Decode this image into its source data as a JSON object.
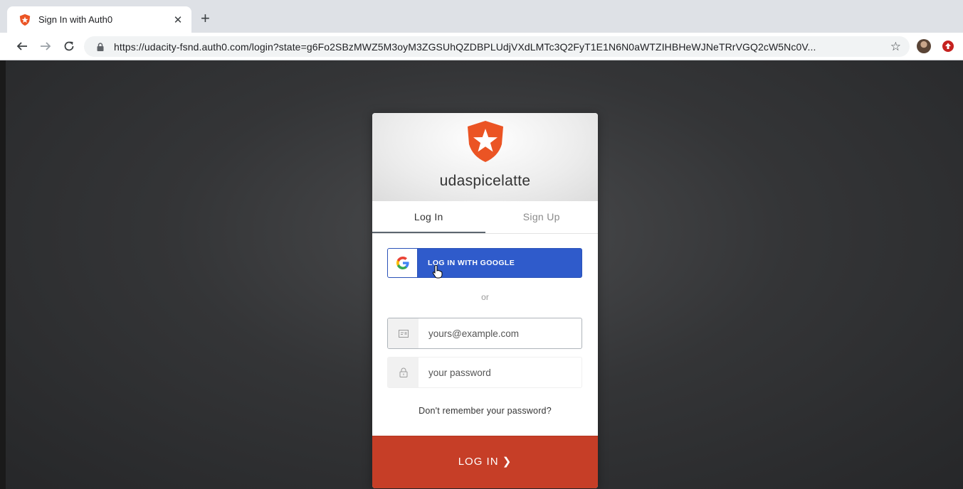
{
  "browser": {
    "tab_title": "Sign In with Auth0",
    "close_glyph": "✕",
    "new_tab_glyph": "+",
    "url_host": "https://udacity-fsnd.auth0.com",
    "url_rest": "/login?state=g6Fo2SBzMWZ5M3oyM3ZGSUhQZDBPLUdjVXdLMTc3Q2FyT1E1N6N0aWTZIHBHeWJNeTRrVGQ2cW5Nc0V...",
    "star_glyph": "☆",
    "icons": [
      "back-icon",
      "forward-icon",
      "reload-icon",
      "lock-icon",
      "star-icon",
      "profile-avatar",
      "extension-icon"
    ]
  },
  "widget": {
    "app_name": "udaspicelatte",
    "tabs": [
      {
        "label": "Log In"
      },
      {
        "label": "Sign Up"
      }
    ],
    "google_button_label": "LOG IN WITH GOOGLE",
    "separator": "or",
    "email_placeholder": "yours@example.com",
    "password_placeholder": "your password",
    "forgot_link": "Don't remember your password?",
    "submit_label": "LOG IN ❯"
  },
  "colors": {
    "brand": "#c63e27",
    "google_button": "#2f5bcb",
    "background": "#2b2c2e"
  }
}
